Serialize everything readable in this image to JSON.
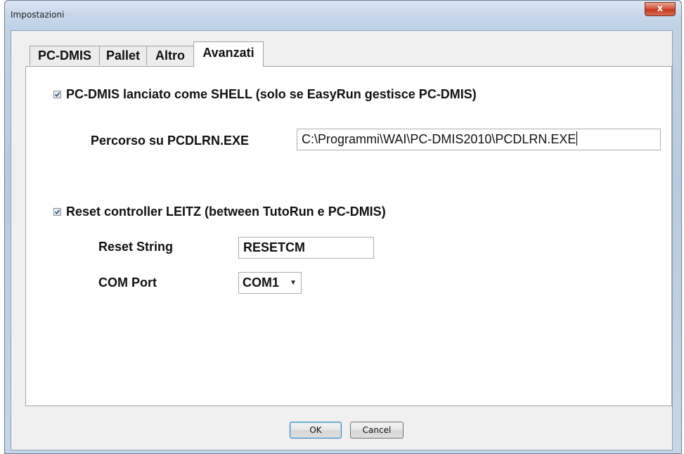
{
  "window": {
    "title": "Impostazioni",
    "close_label": "x"
  },
  "tabs": [
    {
      "label": "PC-DMIS",
      "active": false
    },
    {
      "label": "Pallet",
      "active": false
    },
    {
      "label": "Altro",
      "active": false
    },
    {
      "label": "Avanzati",
      "active": true
    }
  ],
  "shell": {
    "checked": true,
    "checkbox_label": "PC-DMIS lanciato come SHELL (solo se EasyRun gestisce PC-DMIS)",
    "path_label": "Percorso su PCDLRN.EXE",
    "path_value": "C:\\Programmi\\WAI\\PC-DMIS2010\\PCDLRN.EXE"
  },
  "reset": {
    "checked": true,
    "checkbox_label": "Reset controller LEITZ (between TutoRun e PC-DMIS)",
    "string_label": "Reset String",
    "string_value": "RESETCM",
    "port_label": "COM Port",
    "port_value": "COM1"
  },
  "buttons": {
    "ok_label": "OK",
    "cancel_label": "Cancel"
  }
}
